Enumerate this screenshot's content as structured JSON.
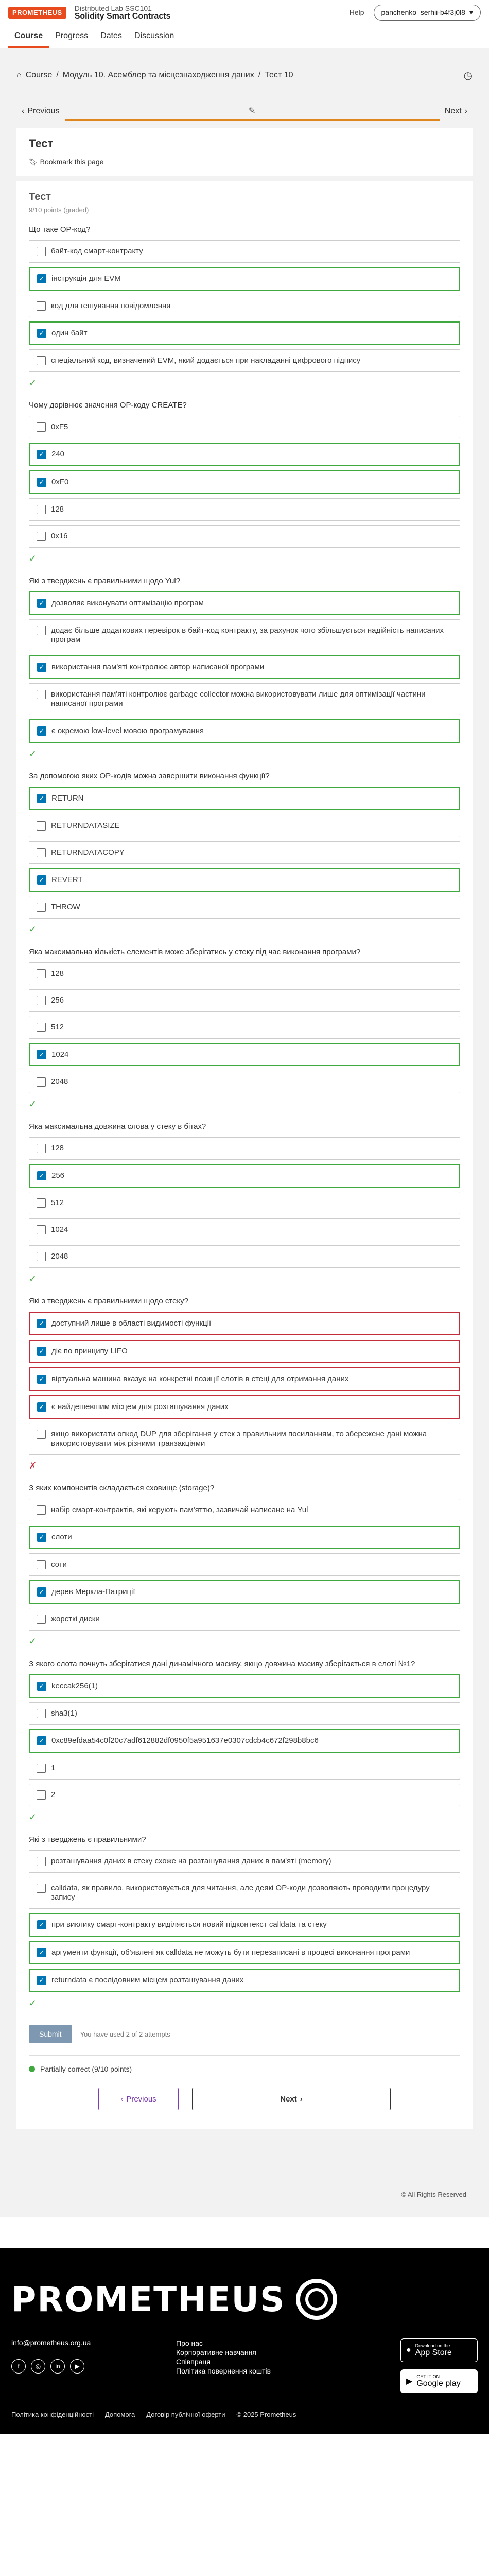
{
  "header": {
    "logo": "PROMETHEUS",
    "org": "Distributed Lab SSC101",
    "course_title": "Solidity Smart Contracts",
    "help": "Help",
    "user": "panchenko_serhii-b4f3j0l8"
  },
  "nav": {
    "tabs": [
      "Course",
      "Progress",
      "Dates",
      "Discussion"
    ]
  },
  "breadcrumb": {
    "course": "Course",
    "sep": "/",
    "module": "Модуль 10. Асемблер та місцезнаходження даних",
    "unit": "Тест 10"
  },
  "sequence": {
    "prev": "Previous",
    "next": "Next"
  },
  "unit": {
    "title": "Тест",
    "bookmark": "Bookmark this page"
  },
  "problem": {
    "title": "Тест",
    "points": "9/10 points (graded)",
    "questions": [
      {
        "text": "Що таке OP-код?",
        "status": "✓",
        "options": [
          {
            "label": "байт-код смарт-контракту",
            "checked": false,
            "state": ""
          },
          {
            "label": "інструкція для EVM",
            "checked": true,
            "state": "correct"
          },
          {
            "label": "код для гешування повідомлення",
            "checked": false,
            "state": ""
          },
          {
            "label": "один байт",
            "checked": true,
            "state": "correct"
          },
          {
            "label": "спеціальний код, визначений EVM, який додається при накладанні цифрового підпису",
            "checked": false,
            "state": ""
          }
        ]
      },
      {
        "text": "Чому дорівнює значення OP-коду CREATE?",
        "status": "✓",
        "options": [
          {
            "label": "0xF5",
            "checked": false,
            "state": ""
          },
          {
            "label": "240",
            "checked": true,
            "state": "correct"
          },
          {
            "label": "0xF0",
            "checked": true,
            "state": "correct"
          },
          {
            "label": "128",
            "checked": false,
            "state": ""
          },
          {
            "label": "0x16",
            "checked": false,
            "state": ""
          }
        ]
      },
      {
        "text": "Які з тверджень є правильними щодо Yul?",
        "status": "✓",
        "options": [
          {
            "label": "дозволяє виконувати оптимізацію програм",
            "checked": true,
            "state": "correct"
          },
          {
            "label": "додає більше додаткових перевірок в байт-код контракту, за рахунок чого збільшується надійність написаних програм",
            "checked": false,
            "state": ""
          },
          {
            "label": "використання пам'яті контролює автор написаної програми",
            "checked": true,
            "state": "correct"
          },
          {
            "label": "використання пам'яті контролює garbage collector можна використовувати лише для оптимізації частини написаної програми",
            "checked": false,
            "state": ""
          },
          {
            "label": "є окремою low-level мовою програмування",
            "checked": true,
            "state": "correct"
          }
        ]
      },
      {
        "text": "За допомогою яких OP-кодів можна завершити виконання функції?",
        "status": "✓",
        "options": [
          {
            "label": "RETURN",
            "checked": true,
            "state": "correct"
          },
          {
            "label": "RETURNDATASIZE",
            "checked": false,
            "state": ""
          },
          {
            "label": "RETURNDATACOPY",
            "checked": false,
            "state": ""
          },
          {
            "label": "REVERT",
            "checked": true,
            "state": "correct"
          },
          {
            "label": "THROW",
            "checked": false,
            "state": ""
          }
        ]
      },
      {
        "text": "Яка максимальна кількість елементів може зберігатись у стеку під час виконання програми?",
        "status": "✓",
        "options": [
          {
            "label": "128",
            "checked": false,
            "state": ""
          },
          {
            "label": "256",
            "checked": false,
            "state": ""
          },
          {
            "label": "512",
            "checked": false,
            "state": ""
          },
          {
            "label": "1024",
            "checked": true,
            "state": "correct"
          },
          {
            "label": "2048",
            "checked": false,
            "state": ""
          }
        ]
      },
      {
        "text": "Яка максимальна довжина слова у стеку в бітах?",
        "status": "✓",
        "options": [
          {
            "label": "128",
            "checked": false,
            "state": ""
          },
          {
            "label": "256",
            "checked": true,
            "state": "correct"
          },
          {
            "label": "512",
            "checked": false,
            "state": ""
          },
          {
            "label": "1024",
            "checked": false,
            "state": ""
          },
          {
            "label": "2048",
            "checked": false,
            "state": ""
          }
        ]
      },
      {
        "text": "Які з тверджень є правильними щодо стеку?",
        "status": "✗",
        "options": [
          {
            "label": "доступний лише в області видимості функції",
            "checked": true,
            "state": "incorrect"
          },
          {
            "label": "діє по принципу LIFO",
            "checked": true,
            "state": "incorrect"
          },
          {
            "label": "віртуальна машина вказує на конкретні позиції слотів в стеці для отримання даних",
            "checked": true,
            "state": "incorrect"
          },
          {
            "label": "є найдешевшим місцем для розташування даних",
            "checked": true,
            "state": "incorrect"
          },
          {
            "label": "якщо використати опкод DUP для зберігання у стек з правильним посиланням, то збережене дані можна використовувати між різними транзакціями",
            "checked": false,
            "state": ""
          }
        ]
      },
      {
        "text": "З яких компонентів складається сховище (storage)?",
        "status": "✓",
        "options": [
          {
            "label": "набір смарт-контрактів, які керують пам'яттю, зазвичай написане на Yul",
            "checked": false,
            "state": ""
          },
          {
            "label": "слоти",
            "checked": true,
            "state": "correct"
          },
          {
            "label": "соти",
            "checked": false,
            "state": ""
          },
          {
            "label": "дерев Меркла-Патриції",
            "checked": true,
            "state": "correct"
          },
          {
            "label": "жорсткі диски",
            "checked": false,
            "state": ""
          }
        ]
      },
      {
        "text": "З якого слота почнуть зберігатися дані динамічного масиву, якщо довжина масиву зберігається в слоті №1?",
        "status": "✓",
        "options": [
          {
            "label": "keccak256(1)",
            "checked": true,
            "state": "correct"
          },
          {
            "label": "sha3(1)",
            "checked": false,
            "state": ""
          },
          {
            "label": "0xc89efdaa54c0f20c7adf612882df0950f5a951637e0307cdcb4c672f298b8bc6",
            "checked": true,
            "state": "correct"
          },
          {
            "label": "1",
            "checked": false,
            "state": ""
          },
          {
            "label": "2",
            "checked": false,
            "state": ""
          }
        ]
      },
      {
        "text": "Які з тверджень є правильними?",
        "status": "✓",
        "options": [
          {
            "label": "розташування даних в стеку схоже на розташування даних в пам'яті (memory)",
            "checked": false,
            "state": ""
          },
          {
            "label": "calldata, як правило, використовується для читання, але деякі OP-коди дозволяють проводити процедуру запису",
            "checked": false,
            "state": ""
          },
          {
            "label": "при виклику смарт-контракту виділяється новий підконтекст calldata та стеку",
            "checked": true,
            "state": "correct"
          },
          {
            "label": "аргументи функції, об'явлені як calldata не можуть бути перезаписані в процесі виконання програми",
            "checked": true,
            "state": "correct"
          },
          {
            "label": "returndata є послідовним місцем розташування даних",
            "checked": true,
            "state": "correct"
          }
        ]
      }
    ],
    "submit": "Submit",
    "attempts": "You have used 2 of 2 attempts",
    "result": "Partially correct (9/10 points)"
  },
  "bottom_nav": {
    "prev": "Previous",
    "next": "Next"
  },
  "rights": "© All Rights Reserved",
  "footer": {
    "logo": "PROMETHEUS",
    "email": "info@prometheus.org.ua",
    "social": [
      "f",
      "◎",
      "in",
      "▶"
    ],
    "links": [
      "Про нас",
      "Корпоративне навчання",
      "Співпраця",
      "Політика повернення коштів"
    ],
    "apps": {
      "apple_small": "Download on the",
      "apple": "App Store",
      "google_small": "GET IT ON",
      "google": "Google play"
    },
    "bottom": [
      "Політика конфіденційності",
      "Допомога",
      "Договір публічної оферти",
      "© 2025 Prometheus"
    ]
  },
  "colors": {
    "accent": "#e8491d",
    "correct": "#3fa83f",
    "incorrect": "#c32d3a",
    "checkbox": "#0075b4"
  }
}
